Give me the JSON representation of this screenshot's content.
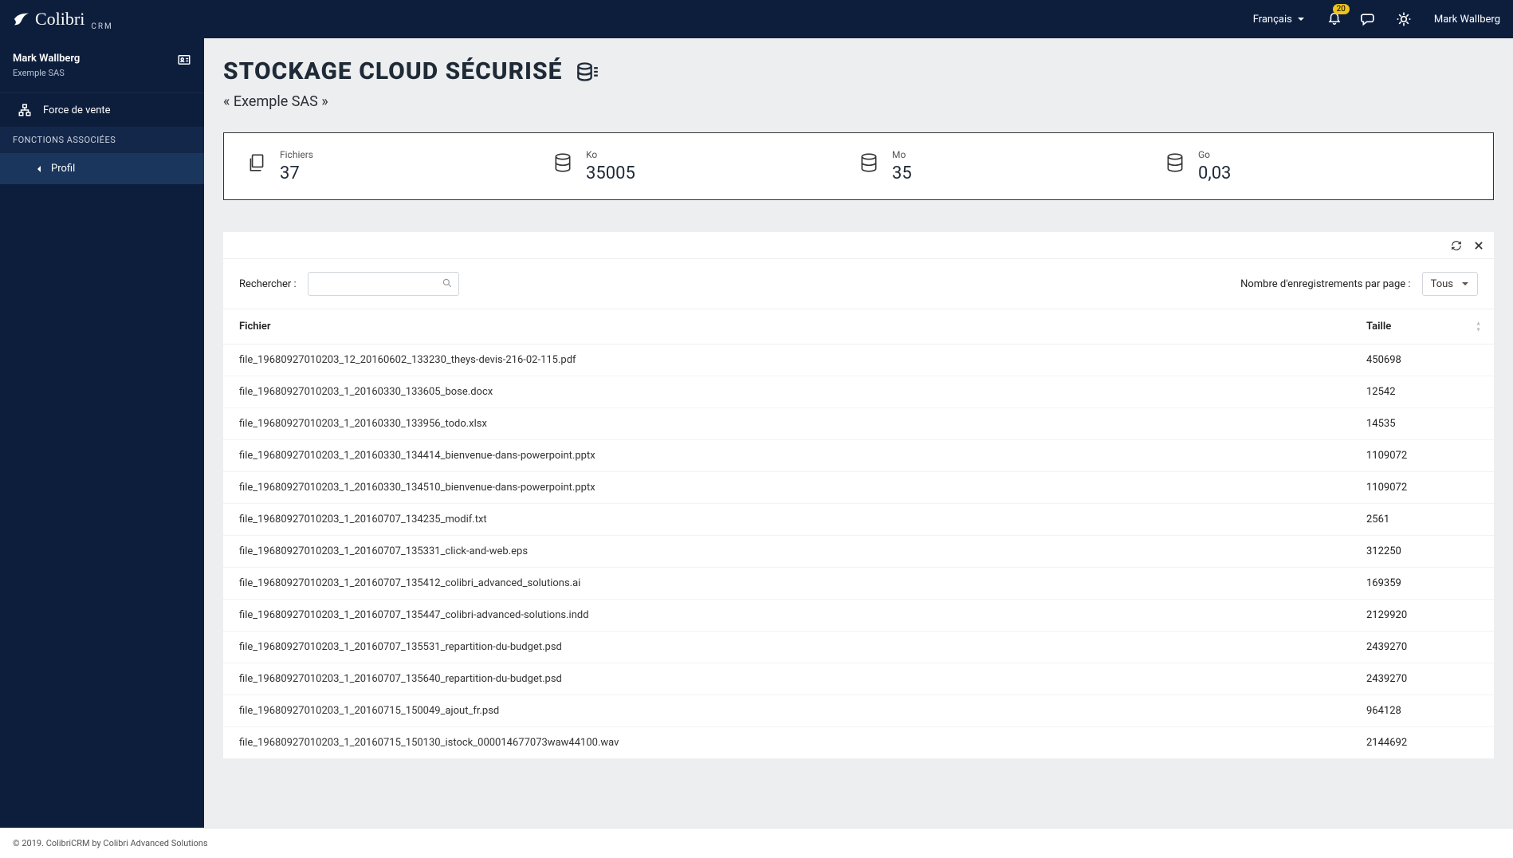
{
  "brand": {
    "name": "Colibri",
    "sub": "CRM"
  },
  "topbar": {
    "language": "Français",
    "notification_count": "20",
    "username": "Mark Wallberg"
  },
  "sidebar": {
    "user": {
      "name": "Mark Wallberg",
      "company": "Exemple SAS"
    },
    "nav_item": "Force de vente",
    "section_label": "FONCTIONS ASSOCIÉES",
    "sub_item": "Profil"
  },
  "page": {
    "title": "STOCKAGE CLOUD SÉCURISÉ",
    "breadcrumb": "« Exemple SAS »"
  },
  "stats": [
    {
      "label": "Fichiers",
      "value": "37"
    },
    {
      "label": "Ko",
      "value": "35005"
    },
    {
      "label": "Mo",
      "value": "35"
    },
    {
      "label": "Go",
      "value": "0,03"
    }
  ],
  "table": {
    "search_label": "Rechercher :",
    "per_page_label": "Nombre d'enregistrements par page :",
    "per_page_value": "Tous",
    "columns": {
      "file": "Fichier",
      "size": "Taille"
    },
    "rows": [
      {
        "file": "file_19680927010203_12_20160602_133230_theys-devis-216-02-115.pdf",
        "size": "450698"
      },
      {
        "file": "file_19680927010203_1_20160330_133605_bose.docx",
        "size": "12542"
      },
      {
        "file": "file_19680927010203_1_20160330_133956_todo.xlsx",
        "size": "14535"
      },
      {
        "file": "file_19680927010203_1_20160330_134414_bienvenue-dans-powerpoint.pptx",
        "size": "1109072"
      },
      {
        "file": "file_19680927010203_1_20160330_134510_bienvenue-dans-powerpoint.pptx",
        "size": "1109072"
      },
      {
        "file": "file_19680927010203_1_20160707_134235_modif.txt",
        "size": "2561"
      },
      {
        "file": "file_19680927010203_1_20160707_135331_click-and-web.eps",
        "size": "312250"
      },
      {
        "file": "file_19680927010203_1_20160707_135412_colibri_advanced_solutions.ai",
        "size": "169359"
      },
      {
        "file": "file_19680927010203_1_20160707_135447_colibri-advanced-solutions.indd",
        "size": "2129920"
      },
      {
        "file": "file_19680927010203_1_20160707_135531_repartition-du-budget.psd",
        "size": "2439270"
      },
      {
        "file": "file_19680927010203_1_20160707_135640_repartition-du-budget.psd",
        "size": "2439270"
      },
      {
        "file": "file_19680927010203_1_20160715_150049_ajout_fr.psd",
        "size": "964128"
      },
      {
        "file": "file_19680927010203_1_20160715_150130_istock_000014677073waw44100.wav",
        "size": "2144692"
      }
    ]
  },
  "footer": "© 2019. ColibriCRM by Colibri Advanced Solutions"
}
